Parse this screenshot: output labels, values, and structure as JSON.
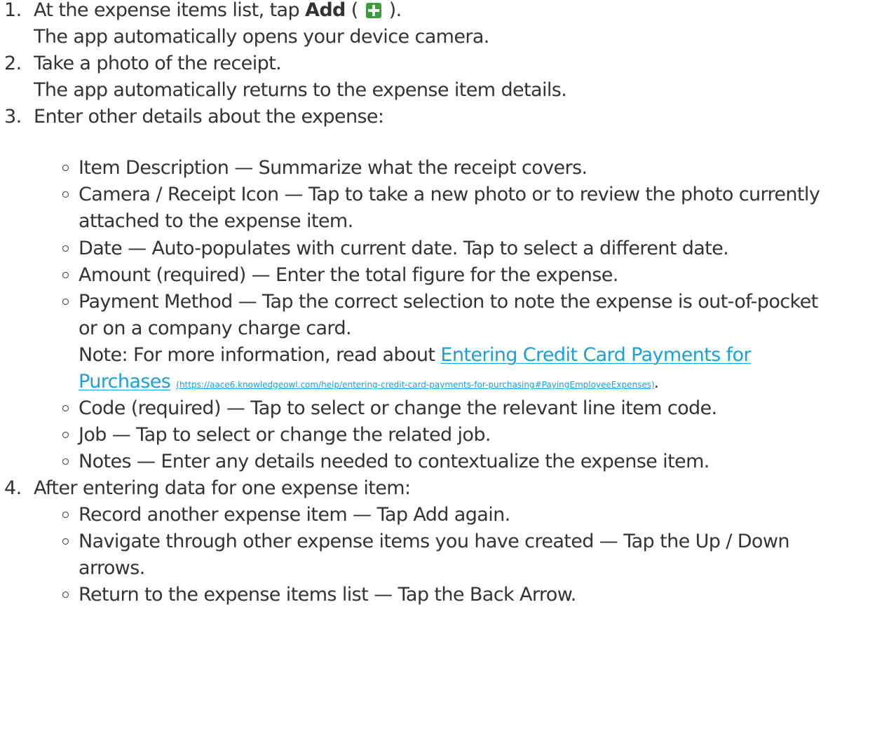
{
  "steps": [
    {
      "number": "1.",
      "text_before": "At the expense items list, tap ",
      "bold": "Add",
      "text_paren_open": " ( ",
      "icon": "add-plus-icon",
      "text_paren_close": " ).",
      "sub": "The app automatically opens your device camera."
    },
    {
      "number": "2.",
      "text": "Take a photo of the receipt.",
      "sub": "The app automatically returns to the expense item details."
    },
    {
      "number": "3.",
      "text": "Enter other details about the expense:",
      "bullets": [
        {
          "text": "Item Description — Summarize what the receipt covers."
        },
        {
          "text": "Camera / Receipt Icon — Tap to take a new photo or to review the photo currently",
          "cont": "attached to the expense item."
        },
        {
          "text": "Date — Auto-populates with current date. Tap to select a different date."
        },
        {
          "text": "Amount (required) — Enter the total figure for the expense."
        },
        {
          "text": "Payment Method — Tap the correct selection to note the expense is out-of-pocket",
          "cont": "or on a company charge card.",
          "note_prefix": "Note: For more information, read about ",
          "link_line1": "Entering Credit Card Payments for",
          "link_line2": "Purchases",
          "url": "(https://aace6.knowledgeowl.com/help/entering-credit-card-payments-for-purchasing#PayingEmployeeExpenses)",
          "url_end": "."
        },
        {
          "text": "Code (required) — Tap to select or change the relevant line item code."
        },
        {
          "text": "Job — Tap to select or change the related job."
        },
        {
          "text": "Notes — Enter any details needed to contextualize the expense item."
        }
      ]
    },
    {
      "number": "4.",
      "text": "After entering data for one expense item:",
      "bullets": [
        {
          "text": "Record another expense item — Tap Add again."
        },
        {
          "text": "Navigate through other expense items you have created — Tap the Up / Down",
          "cont": "arrows."
        },
        {
          "text": "Return to the expense items list — Tap the Back Arrow."
        }
      ]
    }
  ],
  "colors": {
    "text": "#333333",
    "link": "#1a9fd8",
    "add_icon": "#3a9d3a"
  }
}
